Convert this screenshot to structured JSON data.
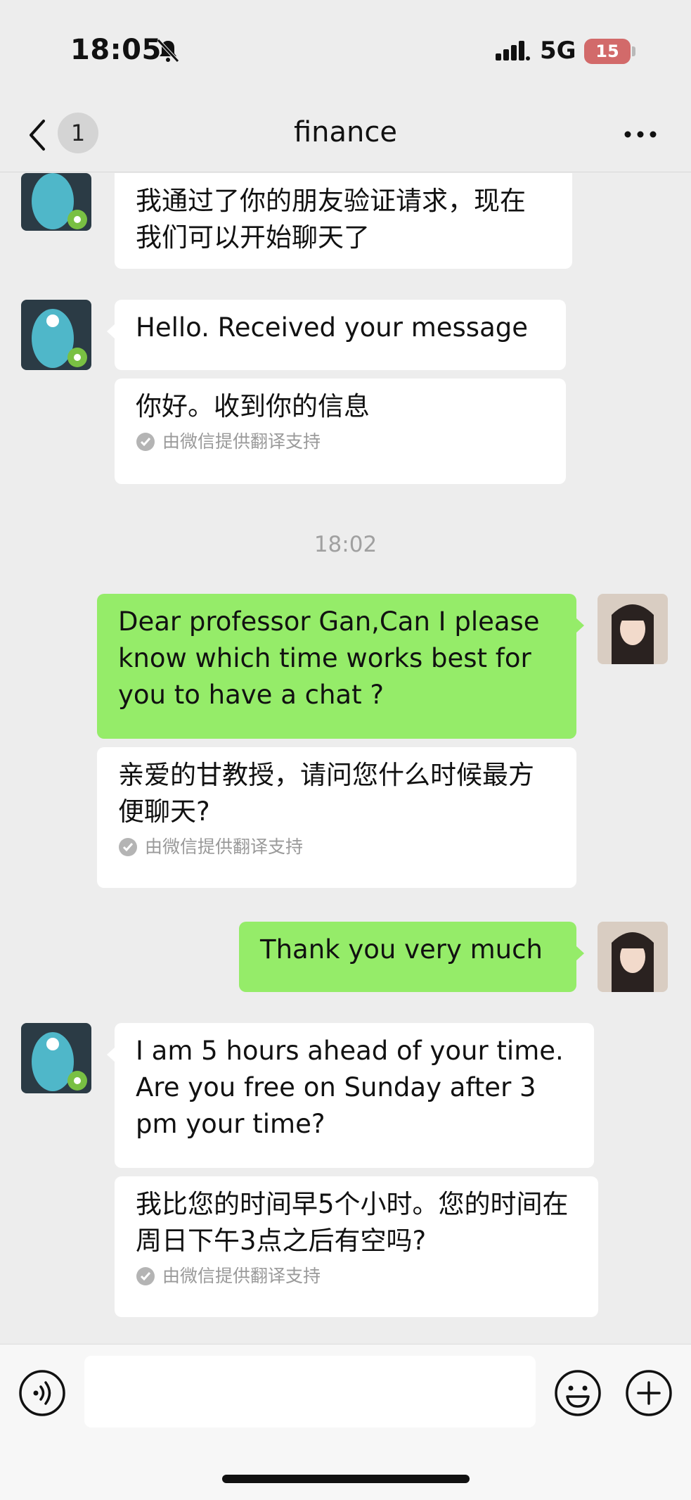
{
  "status_bar": {
    "time": "18:05",
    "network": "5G",
    "battery": "15"
  },
  "nav": {
    "back_badge": "1",
    "title": "finance"
  },
  "messages": [
    {
      "text": "我通过了你的朋友验证请求，现在我们可以开始聊天了"
    },
    {
      "text": "Hello. Received your message"
    },
    {
      "text": "你好。收到你的信息",
      "note": "由微信提供翻译支持"
    },
    {
      "text": "18:02"
    },
    {
      "text": "Dear professor Gan,Can I please know which time works best for you to have a chat ?"
    },
    {
      "text": "亲爱的甘教授，请问您什么时候最方便聊天?",
      "note": "由微信提供翻译支持"
    },
    {
      "text": "Thank you very much"
    },
    {
      "text": "I am 5 hours ahead of your time. Are you free on Sunday after 3 pm your time?"
    },
    {
      "text": "我比您的时间早5个小时。您的时间在周日下午3点之后有空吗?",
      "note": "由微信提供翻译支持"
    }
  ],
  "input": {
    "placeholder": ""
  },
  "colors": {
    "self_bubble": "#95ec69",
    "other_bubble": "#ffffff",
    "background": "#ededed"
  },
  "icons": [
    "bell-muted-icon",
    "signal-icon",
    "back-chevron-icon",
    "more-icon",
    "voice-icon",
    "emoji-icon",
    "plus-icon",
    "check-icon"
  ]
}
